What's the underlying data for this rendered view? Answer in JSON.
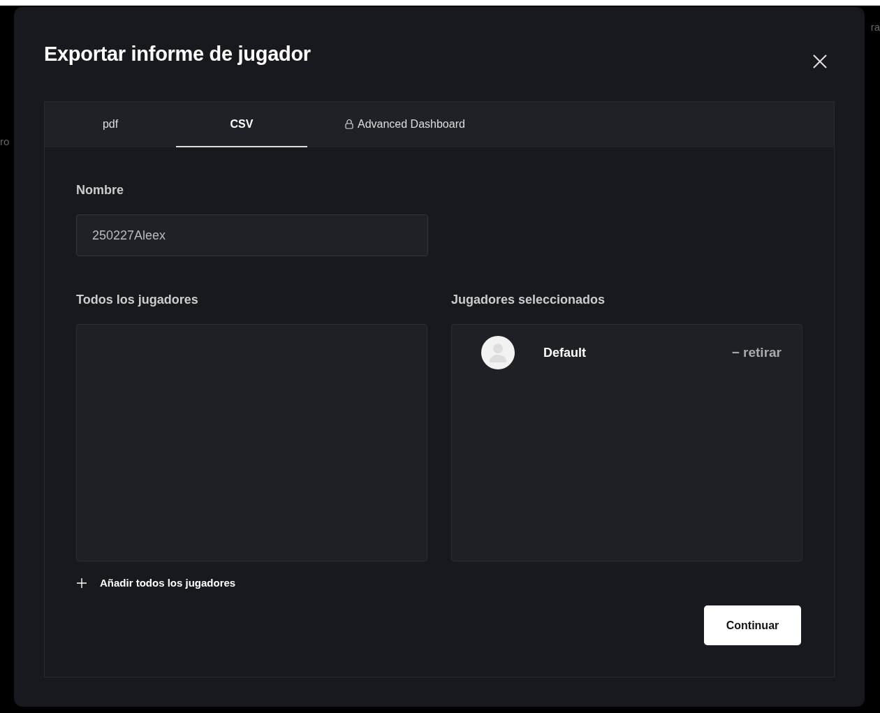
{
  "backdrop": {
    "left_fragment": "ro",
    "right_fragment": "ra"
  },
  "dialog": {
    "title": "Exportar informe de jugador"
  },
  "tabs": [
    {
      "label": "pdf",
      "selected": false,
      "locked": false
    },
    {
      "label": "CSV",
      "selected": true,
      "locked": false
    },
    {
      "label": "Advanced Dashboard",
      "selected": false,
      "locked": true
    }
  ],
  "name_field": {
    "label": "Nombre",
    "value": "250227Aleex"
  },
  "all_players": {
    "label": "Todos los jugadores"
  },
  "selected_players": {
    "label": "Jugadores seleccionados",
    "players": [
      {
        "name": "Default",
        "action": "− retirar"
      }
    ]
  },
  "add_all": {
    "label": "Añadir todos los jugadores"
  },
  "continue_button": {
    "label": "Continuar"
  }
}
